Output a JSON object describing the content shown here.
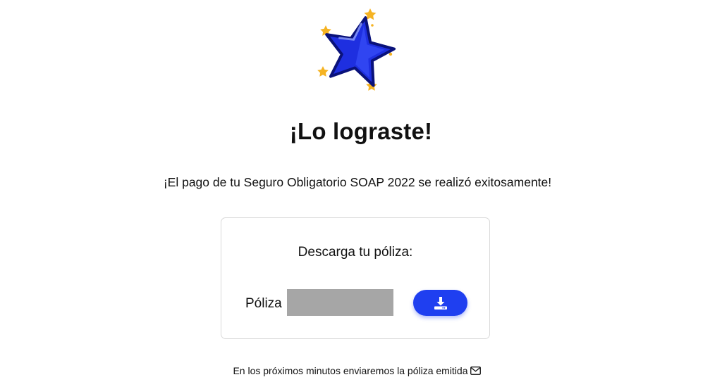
{
  "hero": {
    "icon": "star-icon",
    "star_color": "#1e2fe0",
    "sparkle_color": "#f5b323"
  },
  "title": "¡Lo lograste!",
  "subtitle": "¡El pago de tu Seguro Obligatorio SOAP 2022 se realizó exitosamente!",
  "card": {
    "heading": "Descarga tu póliza:",
    "policy_label": "Póliza",
    "download_icon": "download-icon",
    "accent_color": "#1f3ff0"
  },
  "footer": {
    "note": "En los próximos minutos enviaremos la póliza emitida",
    "icon": "envelope-icon"
  }
}
